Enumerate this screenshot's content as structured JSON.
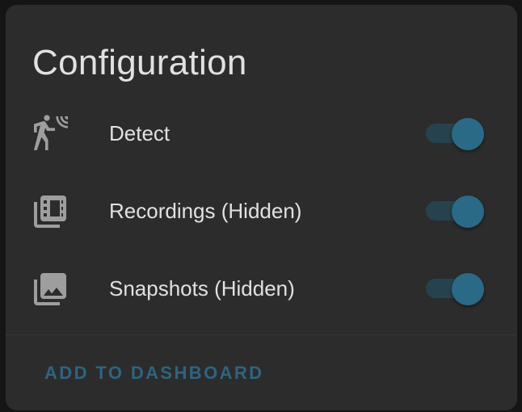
{
  "card": {
    "title": "Configuration",
    "entities": [
      {
        "icon": "motion-sensor-icon",
        "label": "Detect",
        "state": "on"
      },
      {
        "icon": "film-library-icon",
        "label": "Recordings (Hidden)",
        "state": "on"
      },
      {
        "icon": "image-multiple-icon",
        "label": "Snapshots (Hidden)",
        "state": "on"
      }
    ],
    "action_label": "ADD TO DASHBOARD"
  },
  "colors": {
    "card_background": "#2c2c2c",
    "page_background": "#151515",
    "text": "#e1e1e1",
    "icon": "#9e9e9e",
    "toggle_thumb": "#2b6a86",
    "toggle_track": "#26424e",
    "accent_button": "#2f6480"
  }
}
